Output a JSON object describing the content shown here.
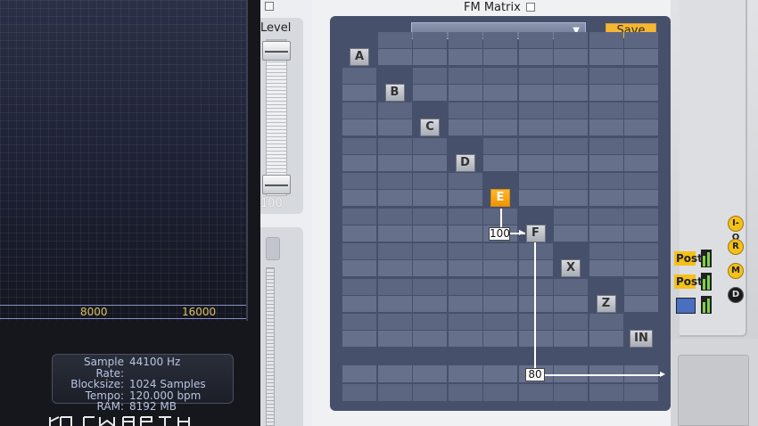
{
  "spectrum": {
    "freq_labels": [
      "8000",
      "16000"
    ]
  },
  "info": {
    "rows": [
      {
        "key": "Sample Rate:",
        "value": "44100 Hz"
      },
      {
        "key": "Blocksize:",
        "value": "1024 Samples"
      },
      {
        "key": "Tempo:",
        "value": "120.000 bpm"
      },
      {
        "key": "RAM:",
        "value": "8192 MB"
      }
    ]
  },
  "level": {
    "label": "Level",
    "value": "100"
  },
  "fm": {
    "title": "FM Matrix",
    "preset_value": "",
    "save_label": "Save",
    "operators": [
      "A",
      "B",
      "C",
      "D",
      "E",
      "F",
      "X",
      "Z",
      "IN"
    ],
    "active_operator": "E",
    "mod_amount_e_to_f": "100",
    "output_amount": "80"
  },
  "right": {
    "post_labels": [
      "Post",
      "Post"
    ],
    "mode_buttons": [
      "I-O",
      "R",
      "M",
      "D"
    ]
  },
  "colors": {
    "accent": "#f5b731",
    "active_operator": "#f5a000",
    "grid_bg": "#47506a"
  }
}
